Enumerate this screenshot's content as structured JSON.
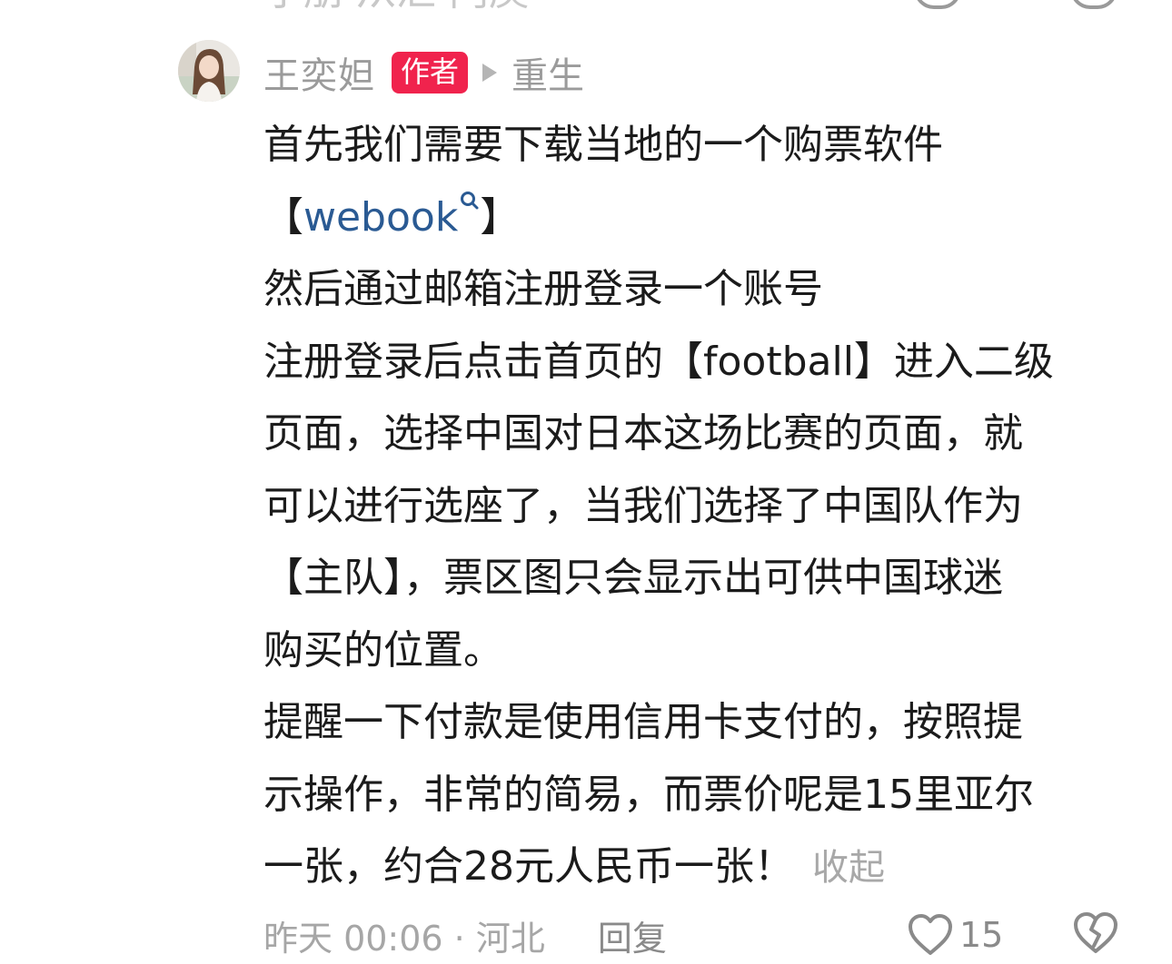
{
  "top_partial_text": "小朋  从汇  门庾",
  "comment": {
    "username": "王奕妲",
    "author_badge": "作者",
    "reply_to": "重生",
    "lines": {
      "l1": "首先我们需要下载当地的一个购票软件",
      "l2_open": "【",
      "l2_link": "webook",
      "l2_close": "】",
      "l3": "然后通过邮箱注册登录一个账号",
      "l4": "注册登录后点击首页的【football】进入二级",
      "l5": "页面，选择中国对日本这场比赛的页面，就",
      "l6": "可以进行选座了，当我们选择了中国队作为",
      "l7": "【主队】，票区图只会显示出可供中国球迷",
      "l8": "购买的位置。",
      "l9": "提醒一下付款是使用信用卡支付的，按照提",
      "l10": "示操作，非常的简易，而票价呢是15里亚尔",
      "l11": "一张，约合28元人民币一张！"
    },
    "collapse_label": "收起",
    "meta": "昨天 00:06 · 河北",
    "reply_label": "回复",
    "like_count": "15"
  },
  "colors": {
    "author_badge": "#f0234d",
    "link": "#2a5a93",
    "muted": "#9b9b9b",
    "text": "#1b1b1b"
  },
  "icons": [
    "search-icon",
    "play-arrow-icon",
    "heart-icon",
    "broken-heart-icon"
  ]
}
